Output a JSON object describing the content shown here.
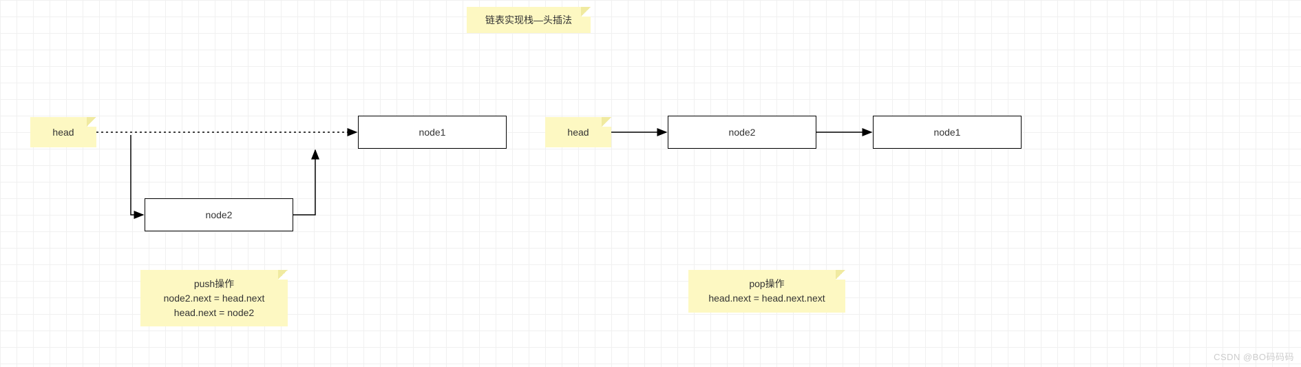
{
  "title": "链表实现栈—头插法",
  "left": {
    "head": "head",
    "node1": "node1",
    "node2": "node2",
    "note": {
      "line1": "push操作",
      "line2": "node2.next = head.next",
      "line3": "head.next = node2"
    }
  },
  "right": {
    "head": "head",
    "node2": "node2",
    "node1": "node1",
    "note": {
      "line1": "pop操作",
      "line2": "head.next = head.next.next"
    }
  },
  "watermark": "CSDN @BO码码码"
}
